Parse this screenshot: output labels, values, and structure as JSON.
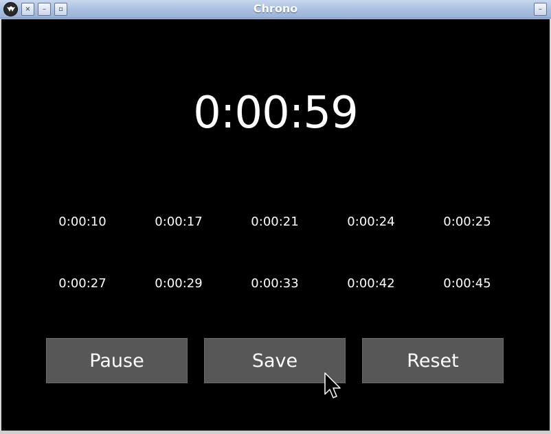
{
  "window": {
    "title": "Chrono",
    "controls": {
      "close": "×",
      "minimize": "–",
      "maximize": "▫",
      "right": "–"
    }
  },
  "stopwatch": {
    "current_time": "0:00:59",
    "laps": [
      "0:00:10",
      "0:00:17",
      "0:00:21",
      "0:00:24",
      "0:00:25",
      "0:00:27",
      "0:00:29",
      "0:00:33",
      "0:00:42",
      "0:00:45"
    ]
  },
  "buttons": {
    "pause_label": "Pause",
    "save_label": "Save",
    "reset_label": "Reset"
  },
  "colors": {
    "background": "#000000",
    "button": "#575757",
    "text": "#ffffff",
    "titlebar": "#a8bfe0"
  }
}
